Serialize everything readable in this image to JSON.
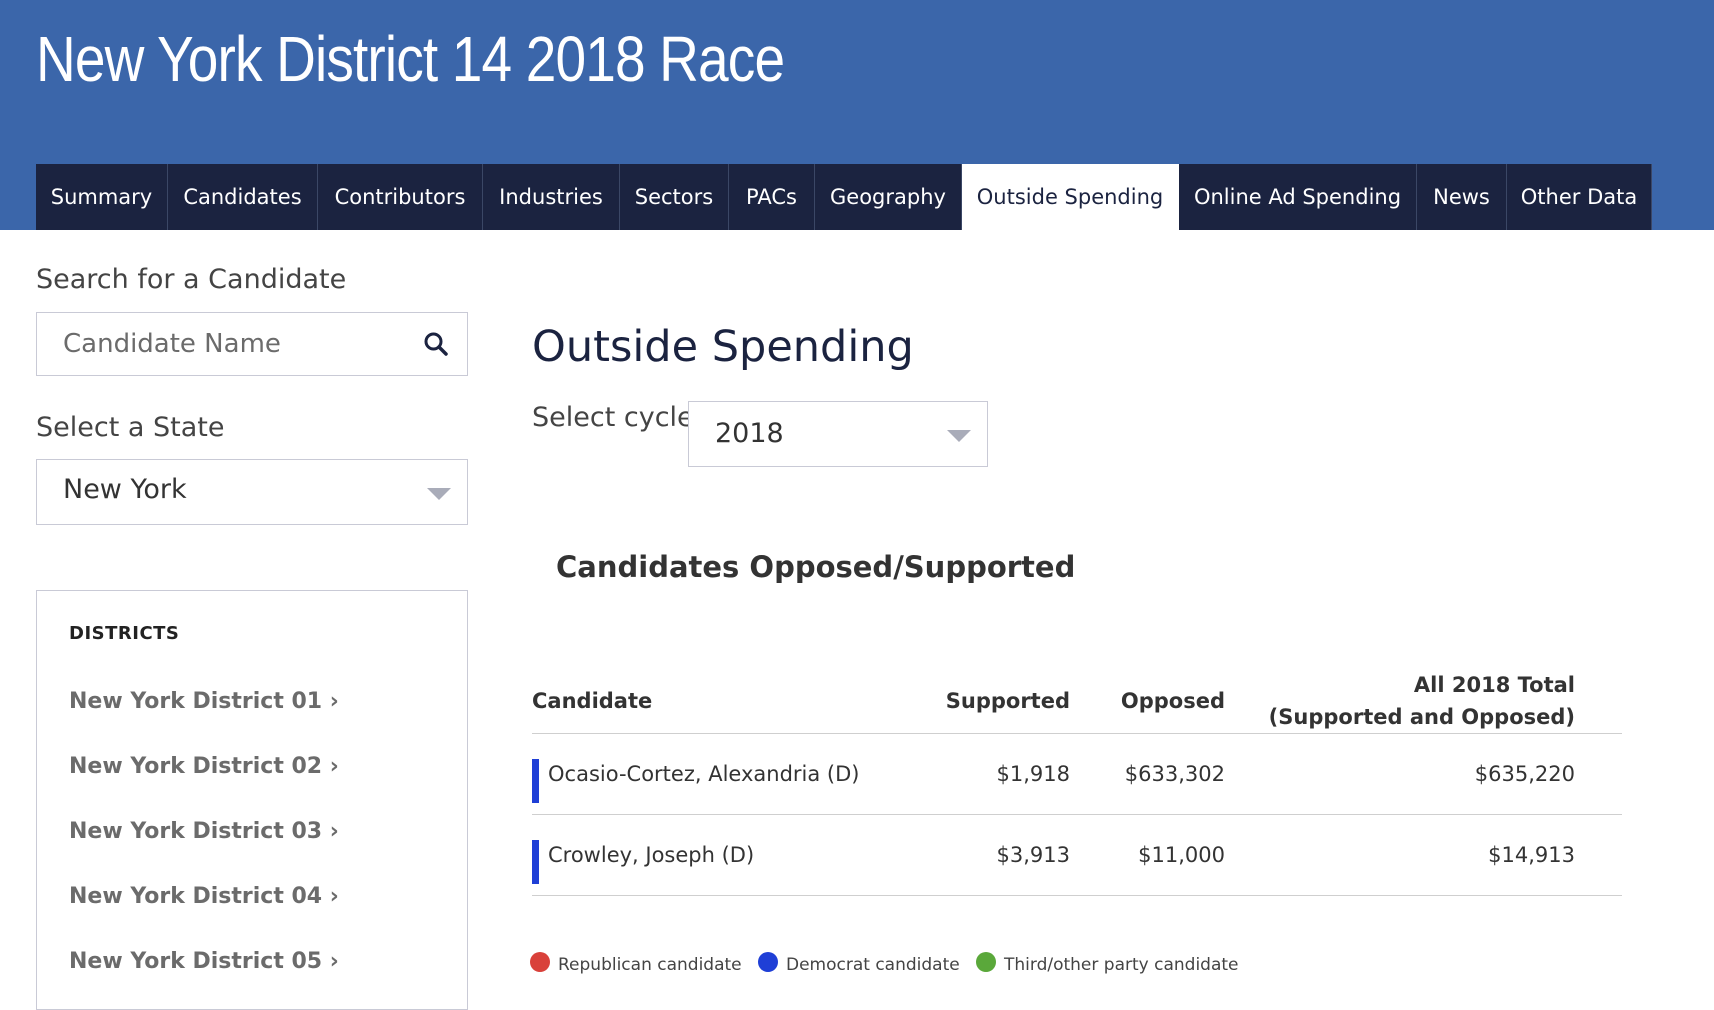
{
  "header": {
    "title": "New York District 14 2018 Race",
    "tabs": [
      {
        "label": "Summary",
        "active": false
      },
      {
        "label": "Candidates",
        "active": false
      },
      {
        "label": "Contributors",
        "active": false
      },
      {
        "label": "Industries",
        "active": false
      },
      {
        "label": "Sectors",
        "active": false
      },
      {
        "label": "PACs",
        "active": false
      },
      {
        "label": "Geography",
        "active": false
      },
      {
        "label": "Outside Spending",
        "active": true
      },
      {
        "label": "Online Ad Spending",
        "active": false
      },
      {
        "label": "News",
        "active": false
      },
      {
        "label": "Other Data",
        "active": false
      }
    ]
  },
  "sidebar": {
    "search_label": "Search for a Candidate",
    "search_placeholder": "Candidate Name",
    "search_icon": "search-icon",
    "state_label": "Select a State",
    "state_value": "New York",
    "districts_heading": "DISTRICTS",
    "districts": [
      "New York District 01 ›",
      "New York District 02 ›",
      "New York District 03 ›",
      "New York District 04 ›",
      "New York District 05 ›"
    ]
  },
  "main": {
    "title": "Outside Spending",
    "cycle_label": "Select cycle:",
    "cycle_value": "2018",
    "section_heading": "Candidates Opposed/Supported",
    "table": {
      "headers": {
        "candidate": "Candidate",
        "supported": "Supported",
        "opposed": "Opposed",
        "total_line1": "All 2018 Total",
        "total_line2": "(Supported and Opposed)"
      },
      "rows": [
        {
          "candidate": "Ocasio-Cortez, Alexandria (D)",
          "supported": "$1,918",
          "opposed": "$633,302",
          "total": "$635,220",
          "party_color": "#1f3fd6"
        },
        {
          "candidate": "Crowley, Joseph (D)",
          "supported": "$3,913",
          "opposed": "$11,000",
          "total": "$14,913",
          "party_color": "#1f3fd6"
        }
      ]
    },
    "legend": [
      {
        "label": "Republican candidate",
        "color": "#d9413a"
      },
      {
        "label": "Democrat candidate",
        "color": "#1f3fd6"
      },
      {
        "label": "Third/other party candidate",
        "color": "#5aa83a"
      }
    ]
  },
  "colors": {
    "header_bg": "#3b66aa",
    "tab_bg": "#1b2340",
    "tab_active_bg": "#ffffff"
  }
}
